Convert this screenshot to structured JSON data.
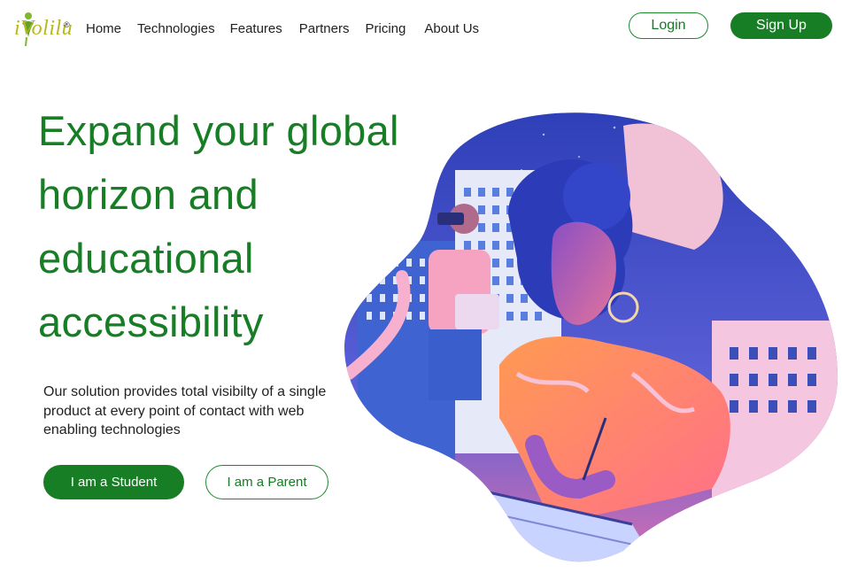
{
  "brand": {
    "name": "i-Volilu",
    "accent": "#177e25",
    "logo_color": "#b8b81c"
  },
  "header": {
    "logo_text": "iVolilu",
    "logo_mark": "®",
    "nav": [
      "Home",
      "Technologies",
      "Features",
      "Partners",
      "Pricing",
      "About Us"
    ],
    "login_label": "Login",
    "signup_label": "Sign Up"
  },
  "hero": {
    "headline_lines": [
      "Expand your global",
      "horizon and",
      "educational",
      "accessibility"
    ],
    "subtext": "Our solution provides total visibilty of a single product at every point of contact with web enabling technologies",
    "primary_cta": "I am a Student",
    "secondary_cta": "I am a Parent",
    "illustration_icon": "student-studying-illustration"
  }
}
